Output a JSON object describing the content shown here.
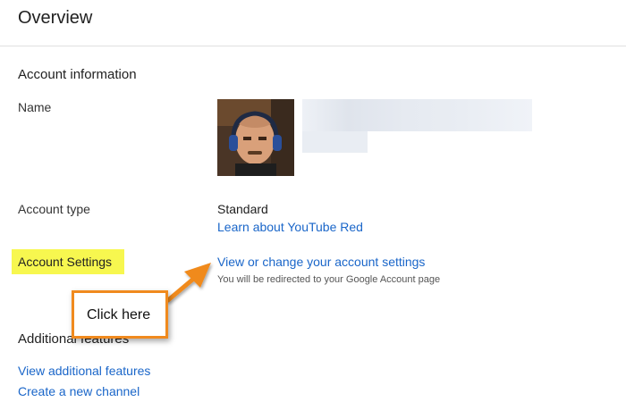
{
  "header": {
    "title": "Overview"
  },
  "account_info": {
    "section_title": "Account information",
    "name_label": "Name",
    "account_type_label": "Account type",
    "account_type_value": "Standard",
    "learn_link": "Learn about YouTube Red",
    "settings_label": "Account Settings",
    "settings_link": "View or change your account settings",
    "settings_note": "You will be redirected to your Google Account page"
  },
  "additional": {
    "section_title": "Additional features",
    "view_features_link": "View additional features",
    "create_channel_link": "Create a new channel"
  },
  "callout": {
    "text": "Click here",
    "color": "#f08a1e"
  },
  "colors": {
    "link": "#1a66c9",
    "highlight": "#f7f74f"
  }
}
